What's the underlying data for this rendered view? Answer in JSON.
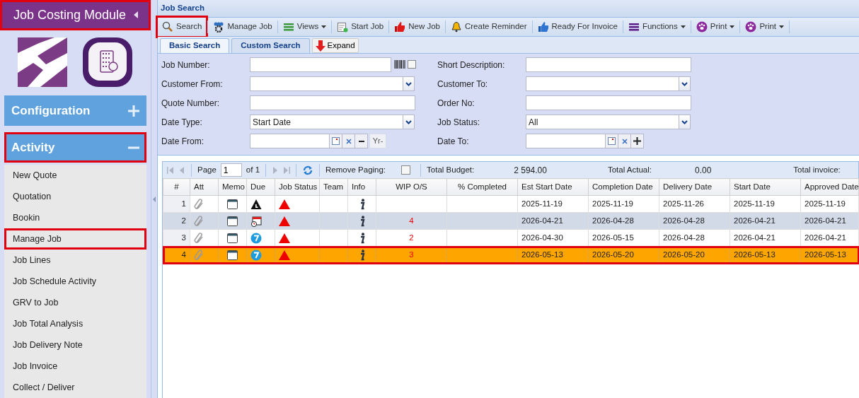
{
  "sidebar": {
    "title": "Job Costing Module",
    "title_highlighted": true,
    "panels": [
      {
        "label": "Configuration",
        "expanded": false,
        "highlighted": false
      },
      {
        "label": "Activity",
        "expanded": true,
        "highlighted": true
      }
    ],
    "items": [
      {
        "label": "New Quote",
        "highlighted": false
      },
      {
        "label": "Quotation",
        "highlighted": false
      },
      {
        "label": "Bookin",
        "highlighted": false
      },
      {
        "label": "Manage Job",
        "highlighted": true
      },
      {
        "label": "Job Lines",
        "highlighted": false
      },
      {
        "label": "Job Schedule Activity",
        "highlighted": false
      },
      {
        "label": "GRV to Job",
        "highlighted": false
      },
      {
        "label": "Job Total Analysis",
        "highlighted": false
      },
      {
        "label": "Job Delivery Note",
        "highlighted": false
      },
      {
        "label": "Job Invoice",
        "highlighted": false
      },
      {
        "label": "Collect / Deliver",
        "highlighted": false
      }
    ]
  },
  "window": {
    "title": "Job Search"
  },
  "toolbar": [
    {
      "label": "Search",
      "kind": "search",
      "dropdown": false,
      "highlighted": true
    },
    {
      "label": "Manage Job",
      "kind": "team",
      "dropdown": false,
      "highlighted": false
    },
    {
      "label": "Views",
      "kind": "views",
      "dropdown": true,
      "highlighted": false
    },
    {
      "label": "Start Job",
      "kind": "start",
      "dropdown": false,
      "highlighted": false
    },
    {
      "label": "New Job",
      "kind": "new",
      "dropdown": false,
      "highlighted": false
    },
    {
      "label": "Create Reminder",
      "kind": "reminder",
      "dropdown": false,
      "highlighted": false
    },
    {
      "label": "Ready For Invoice",
      "kind": "ready",
      "dropdown": false,
      "highlighted": false
    },
    {
      "label": "Functions",
      "kind": "functions",
      "dropdown": true,
      "highlighted": false
    },
    {
      "label": "Print",
      "kind": "print",
      "dropdown": true,
      "highlighted": false
    },
    {
      "label": "Print",
      "kind": "print",
      "dropdown": true,
      "highlighted": false
    }
  ],
  "tabs": [
    {
      "label": "Basic Search",
      "selected": true
    },
    {
      "label": "Custom Search",
      "selected": false
    }
  ],
  "expand_button": {
    "label": "Expand"
  },
  "form": {
    "left": [
      {
        "label": "Job Number:",
        "kind": "barcode",
        "checked": false
      },
      {
        "label": "Customer From:",
        "kind": "combo"
      },
      {
        "label": "Quote Number:",
        "kind": "text"
      },
      {
        "label": "Date Type:",
        "kind": "combo",
        "value": "Start Date"
      },
      {
        "label": "Date From:",
        "kind": "date-year",
        "year_button": "Yr-"
      }
    ],
    "right": [
      {
        "label": "Short Description:",
        "kind": "text"
      },
      {
        "label": "Customer To:",
        "kind": "combo"
      },
      {
        "label": "Order No:",
        "kind": "text"
      },
      {
        "label": "Job Status:",
        "kind": "combo",
        "value": "All"
      },
      {
        "label": "Date To:",
        "kind": "date-plus"
      }
    ]
  },
  "paging": {
    "page_label": "Page",
    "page": "1",
    "of": "of 1",
    "remove_paging_label": "Remove Paging:",
    "remove_paging": false,
    "totals": [
      {
        "label": "Total Budget:",
        "value": "2 594.00"
      },
      {
        "label": "Total Actual:",
        "value": "0.00"
      },
      {
        "label": "Total invoice:"
      }
    ]
  },
  "table": {
    "columns": [
      "#",
      "Att",
      "Memo",
      "Due",
      "Job Status",
      "Team",
      "Info",
      "WIP O/S",
      "% Completed",
      "Est Start Date",
      "Completion Date",
      "Delivery Date",
      "Start Date",
      "Approved Date"
    ],
    "rows": [
      {
        "number": "1",
        "due": {
          "kind": "warning"
        },
        "dates": [
          "2025-11-19",
          "2025-11-19",
          "2025-11-26",
          "2025-11-19",
          "2025-11-19"
        ],
        "selected": false,
        "highlighted": false
      },
      {
        "number": "2",
        "due": {
          "kind": "overdue"
        },
        "wip": "4",
        "dates": [
          "2026-04-21",
          "2026-04-28",
          "2026-04-28",
          "2026-04-21",
          "2026-04-21"
        ],
        "selected": false,
        "highlighted": false
      },
      {
        "number": "3",
        "due": {
          "kind": "days"
        },
        "wip": "2",
        "dates": [
          "2026-04-30",
          "2026-05-15",
          "2026-04-28",
          "2026-04-21",
          "2026-04-21"
        ],
        "selected": false,
        "highlighted": false
      },
      {
        "number": "4",
        "due": {
          "kind": "days"
        },
        "wip": "3",
        "dates": [
          "2026-05-13",
          "2026-05-20",
          "2026-05-20",
          "2026-05-13",
          "2026-05-13"
        ],
        "selected": true,
        "highlighted": true
      }
    ]
  }
}
